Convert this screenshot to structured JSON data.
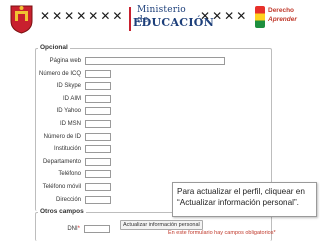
{
  "header": {
    "pattern_glyph": "✕",
    "ministry_line1": "Ministerio de",
    "ministry_line2": "EDUCACIÓN",
    "rights_line1": "Derecho",
    "rights_line2": "Aprender",
    "colors": {
      "ministry": "#1d3f7a",
      "accent_red": "#c8202e"
    }
  },
  "optional": {
    "legend": "Opcional",
    "fields": [
      {
        "label": "Página web"
      },
      {
        "label": "Número de ICQ"
      },
      {
        "label": "ID Skype"
      },
      {
        "label": "ID AIM"
      },
      {
        "label": "ID Yahoo"
      },
      {
        "label": "ID MSN"
      },
      {
        "label": "Número de ID"
      },
      {
        "label": "Institución"
      },
      {
        "label": "Departamento"
      },
      {
        "label": "Teléfono"
      },
      {
        "label": "Teléfono móvil"
      },
      {
        "label": "Dirección"
      }
    ]
  },
  "other": {
    "legend": "Otros campos",
    "dni_label": "DNI",
    "required_mark": "*"
  },
  "tooltip": {
    "text": "Para actualizar el perfil, cliquear en “Actualizar información personal”."
  },
  "footer": {
    "update_button": "Actualizar información personal",
    "required_note": "En este formulario hay campos obligatorios*"
  }
}
